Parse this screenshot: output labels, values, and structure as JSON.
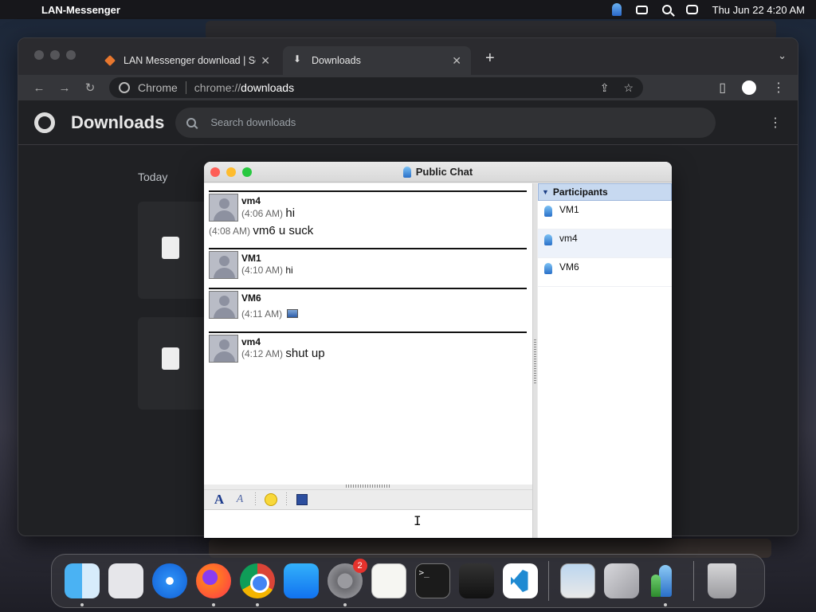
{
  "menubar": {
    "apple_icon": "apple-icon",
    "app_name": "LAN-Messenger",
    "datetime": "Thu Jun 22  4:20 AM"
  },
  "chrome": {
    "tabs": [
      {
        "label": "LAN Messenger download | So",
        "active": false
      },
      {
        "label": "Downloads",
        "active": true
      }
    ],
    "omnibox": {
      "site": "Chrome",
      "scheme": "chrome://",
      "host": "downloads"
    },
    "page": {
      "title": "Downloads",
      "search_placeholder": "Search downloads",
      "section": "Today"
    }
  },
  "chat": {
    "title": "Public Chat",
    "messages": [
      {
        "sender": "vm4",
        "lines": [
          {
            "time": "(4:06 AM)",
            "text": "hi"
          }
        ],
        "extra": {
          "time": "(4:08 AM)",
          "text": "vm6 u suck"
        }
      },
      {
        "sender": "VM1",
        "lines": [
          {
            "time": "(4:10 AM)",
            "text": "hi"
          }
        ]
      },
      {
        "sender": "VM6",
        "lines": [
          {
            "time": "(4:11 AM)",
            "text": ""
          }
        ]
      },
      {
        "sender": "vm4",
        "lines": [
          {
            "time": "(4:12 AM)",
            "text": "shut up"
          }
        ]
      }
    ],
    "participants_header": "Participants",
    "participants": [
      "VM1",
      "vm4",
      "VM6"
    ]
  },
  "dock": {
    "items": [
      "Finder",
      "Launchpad",
      "Safari",
      "Firefox",
      "Google Chrome",
      "App Store",
      "System Settings",
      "TextEdit",
      "Terminal",
      "GarageBand",
      "Visual Studio Code",
      "Preview",
      "Boot Camp Assistant",
      "LAN Messenger",
      "Trash"
    ],
    "settings_badge": "2"
  },
  "colors": {
    "participants_header_bg": "#c7d9f0",
    "close_light": "#fe5f57",
    "minimize_light": "#febc2e",
    "zoom_light": "#28c840",
    "badge": "#e5322d"
  }
}
